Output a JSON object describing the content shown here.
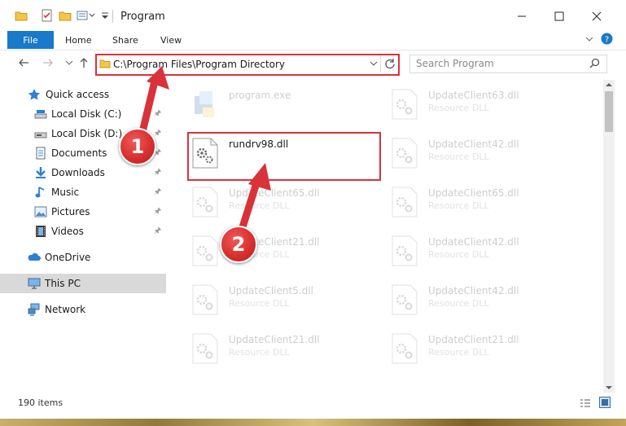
{
  "window": {
    "title": "Program"
  },
  "ribbon": {
    "tabs": [
      "File",
      "Home",
      "Share",
      "View"
    ]
  },
  "address": {
    "path": "C:\\Program Files\\Program Directory"
  },
  "search": {
    "placeholder": "Search Program"
  },
  "nav": {
    "quick_access": "Quick access",
    "items": [
      {
        "label": "Local Disk (C:)",
        "icon": "local-disk-icon"
      },
      {
        "label": "Local Disk (D:)",
        "icon": "local-disk-icon"
      },
      {
        "label": "Documents",
        "icon": "documents-icon"
      },
      {
        "label": "Downloads",
        "icon": "downloads-icon"
      },
      {
        "label": "Music",
        "icon": "music-icon"
      },
      {
        "label": "Pictures",
        "icon": "pictures-icon"
      },
      {
        "label": "Videos",
        "icon": "videos-icon"
      }
    ],
    "onedrive": "OneDrive",
    "this_pc": "This PC",
    "network": "Network"
  },
  "files": [
    {
      "name": "program.exe",
      "desc": ""
    },
    {
      "name": "UpdateClient63.dll",
      "desc": "Resource DLL"
    },
    {
      "name": "rundrv98.dll",
      "desc": ""
    },
    {
      "name": "UpdateClient42.dll",
      "desc": "Resource DLL"
    },
    {
      "name": "UpdateClient65.dll",
      "desc": "Resource DLL"
    },
    {
      "name": "UpdateClient65.dll",
      "desc": "Resource DLL"
    },
    {
      "name": "UpdateClient21.dll",
      "desc": "Resource DLL"
    },
    {
      "name": "UpdateClient42.dll",
      "desc": "Resource DLL"
    },
    {
      "name": "UpdateClient5.dll",
      "desc": "Resource DLL"
    },
    {
      "name": "UpdateClient42.dll",
      "desc": "Resource DLL"
    },
    {
      "name": "UpdateClient21.dll",
      "desc": "Resource DLL"
    },
    {
      "name": "UpdateClient21.dll",
      "desc": "Resource DLL"
    }
  ],
  "status": {
    "count": "190 items"
  },
  "annotations": {
    "step1": "1",
    "step2": "2"
  },
  "colors": {
    "accent": "#1979ca",
    "highlight": "#d9323a"
  }
}
